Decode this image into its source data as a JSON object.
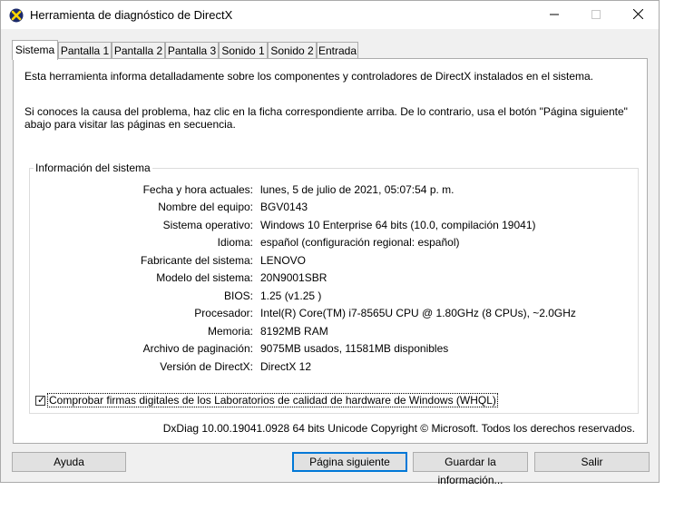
{
  "window": {
    "title": "Herramienta de diagnóstico de DirectX",
    "controls": {
      "minimize_icon": "minimize-icon",
      "maximize_icon": "maximize-icon",
      "close_icon": "close-icon"
    }
  },
  "tabs": [
    {
      "label": "Sistema",
      "active": true
    },
    {
      "label": "Pantalla 1"
    },
    {
      "label": "Pantalla 2"
    },
    {
      "label": "Pantalla 3"
    },
    {
      "label": "Sonido 1"
    },
    {
      "label": "Sonido 2"
    },
    {
      "label": "Entrada"
    }
  ],
  "intro": {
    "line1": "Esta herramienta informa detalladamente sobre los componentes y controladores de DirectX instalados en el sistema.",
    "line2": "Si conoces la causa del problema, haz clic en la ficha correspondiente arriba. De lo contrario, usa el botón \"Página siguiente\" abajo para visitar las páginas en secuencia."
  },
  "system_info": {
    "legend": "Información del sistema",
    "rows": [
      {
        "label": "Fecha y hora actuales:",
        "value": "lunes, 5 de julio de 2021, 05:07:54 p. m."
      },
      {
        "label": "Nombre del equipo:",
        "value": "BGV0143"
      },
      {
        "label": "Sistema operativo:",
        "value": "Windows 10 Enterprise 64 bits (10.0, compilación 19041)"
      },
      {
        "label": "Idioma:",
        "value": "español (configuración regional: español)"
      },
      {
        "label": "Fabricante del sistema:",
        "value": "LENOVO"
      },
      {
        "label": "Modelo del sistema:",
        "value": "20N9001SBR"
      },
      {
        "label": "BIOS:",
        "value": "1.25 (v1.25 )"
      },
      {
        "label": "Procesador:",
        "value": "Intel(R) Core(TM) i7-8565U CPU @ 1.80GHz (8 CPUs), ~2.0GHz"
      },
      {
        "label": "Memoria:",
        "value": "8192MB RAM"
      },
      {
        "label": "Archivo de paginación:",
        "value": "9075MB usados, 11581MB disponibles"
      },
      {
        "label": "Versión de DirectX:",
        "value": "DirectX 12"
      }
    ],
    "whql_checkbox": {
      "label": "Comprobar firmas digitales de los Laboratorios de calidad de hardware de Windows (WHQL)",
      "checked": true
    }
  },
  "copyright": "DxDiag 10.00.19041.0928 64 bits Unicode  Copyright © Microsoft. Todos los derechos reservados.",
  "buttons": {
    "help": "Ayuda",
    "next_page": "Página siguiente",
    "save_info": "Guardar la información...",
    "exit": "Salir"
  },
  "colors": {
    "accent": "#0078d7",
    "window_bg": "#f0f0f0",
    "panel_bg": "#ffffff",
    "border": "#adadad"
  }
}
